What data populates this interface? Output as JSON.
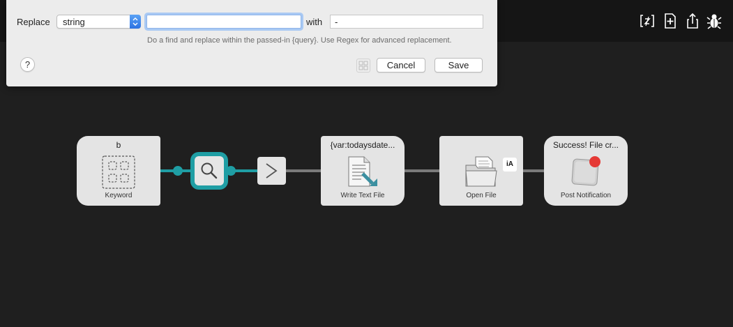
{
  "toolbar": {
    "icons": [
      "variable-icon",
      "add-icon",
      "export-icon",
      "debug-bug-icon"
    ]
  },
  "dialog": {
    "replace_label": "Replace",
    "mode_select": {
      "selected": "string"
    },
    "find_input": {
      "value": ""
    },
    "with_label": "with",
    "replace_input": {
      "value": "-"
    },
    "hint": "Do a find and replace within the passed-in {query}. Use Regex for advanced replacement.",
    "help_label": "?",
    "cancel_label": "Cancel",
    "save_label": "Save"
  },
  "workflow": {
    "keyword_node": {
      "title": "b",
      "caption": "Keyword"
    },
    "filter_node": {
      "icon": "search-icon"
    },
    "arrow_node": {
      "icon": "chevron-right-icon"
    },
    "write_text_node": {
      "title": "{var:todaysdate...",
      "caption": "Write Text File"
    },
    "open_file_node": {
      "caption": "Open File",
      "app_badge": "iA"
    },
    "notification_node": {
      "title": "Success! File cr...",
      "caption": "Post Notification"
    }
  },
  "colors": {
    "accent_teal": "#1f9ea4",
    "select_blue": "#2c72e3",
    "notification_red": "#e53935",
    "background": "#1f1f1f"
  }
}
